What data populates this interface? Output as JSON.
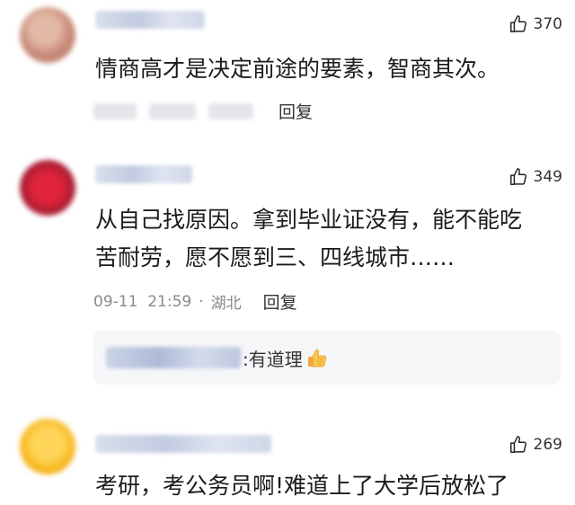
{
  "comments": [
    {
      "likes": "370",
      "text": "情商高才是决定前途的要素，智商其次。",
      "date": "",
      "location": "",
      "reply_label": "回复"
    },
    {
      "likes": "349",
      "text_line1": "从自己找原因。拿到毕业证没有，能不能吃",
      "text_line2": "苦耐劳，愿不愿到三、四线城市……",
      "date": "09-11  21:59",
      "separator": "·",
      "location": "湖北",
      "reply_label": "回复",
      "sub_reply": {
        "text": ":有道理",
        "emoji": "thumbs-up-emoji"
      }
    },
    {
      "likes": "269",
      "text": "考研，考公务员啊!难道上了大学后放松了"
    }
  ],
  "icons": {
    "like": "thumbs-up-outline-icon"
  },
  "colors": {
    "text": "#1b1b1b",
    "meta": "#8a8a8a",
    "subreply_bg": "#f5f6f7"
  }
}
